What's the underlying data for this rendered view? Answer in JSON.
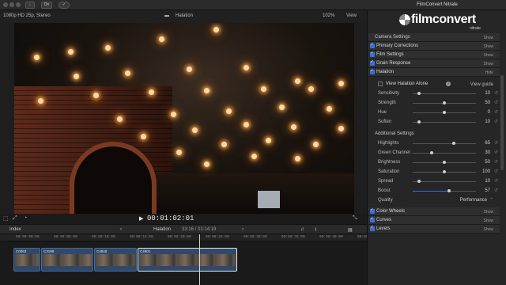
{
  "window": {
    "plugin_title": "FilmConvert Nitrate"
  },
  "toolbar": {
    "zoom_ctrl": "On"
  },
  "viewer": {
    "format": "1080p HD 25p, Stereo",
    "clip_name": "Halation",
    "zoom": "102%",
    "view_label": "View",
    "timecode": "00:01:02:01"
  },
  "timeline": {
    "index_label": "Index",
    "project_name": "Halation",
    "duration": "33:16 / 01:14:19",
    "ruler": [
      "00:00:00:00",
      "00:00:05:00",
      "00:00:10:00",
      "00:00:15:00",
      "00:00:20:00",
      "00:00:25:00",
      "00:00:30:00",
      "00:00:35:00",
      "00:00:40:00",
      "00:00:45:00"
    ],
    "clips": [
      "C0063",
      "C3198",
      "C4948",
      "C4901"
    ]
  },
  "inspector": {
    "logo": "filmconvert",
    "logo_sub": "nitrate",
    "sections_top": [
      {
        "name": "Camera Settings",
        "action": "Show",
        "checkbox": false
      },
      {
        "name": "Primary Corrections",
        "action": "Show",
        "checkbox": true
      },
      {
        "name": "Film Settings",
        "action": "Show",
        "checkbox": true
      },
      {
        "name": "Grain Response",
        "action": "Show",
        "checkbox": true
      },
      {
        "name": "Halation",
        "action": "Hide",
        "checkbox": true
      }
    ],
    "view_alone": "View Halation Alone",
    "view_guide": "View guide",
    "params_basic": [
      {
        "name": "Sensitivity",
        "value": "10",
        "pos": 0.1
      },
      {
        "name": "Strength",
        "value": "50",
        "pos": 0.5
      },
      {
        "name": "Hue",
        "value": "0",
        "pos": 0.5
      },
      {
        "name": "Soften",
        "value": "10",
        "pos": 0.1
      }
    ],
    "additional_label": "Additional Settings",
    "params_additional": [
      {
        "name": "Highlights",
        "value": "65",
        "pos": 0.65
      },
      {
        "name": "Green Channel",
        "value": "30",
        "pos": 0.3
      },
      {
        "name": "Brightness",
        "value": "50",
        "pos": 0.5
      },
      {
        "name": "Saturation",
        "value": "100",
        "pos": 0.5
      },
      {
        "name": "Spread",
        "value": "10",
        "pos": 0.1
      },
      {
        "name": "Boost",
        "value": "57",
        "pos": 0.57
      }
    ],
    "quality_label": "Quality",
    "quality_value": "Performance",
    "sections_bottom": [
      {
        "name": "Color Wheels",
        "action": "Show"
      },
      {
        "name": "Curves",
        "action": "Show"
      },
      {
        "name": "Levels",
        "action": "Show"
      }
    ]
  }
}
